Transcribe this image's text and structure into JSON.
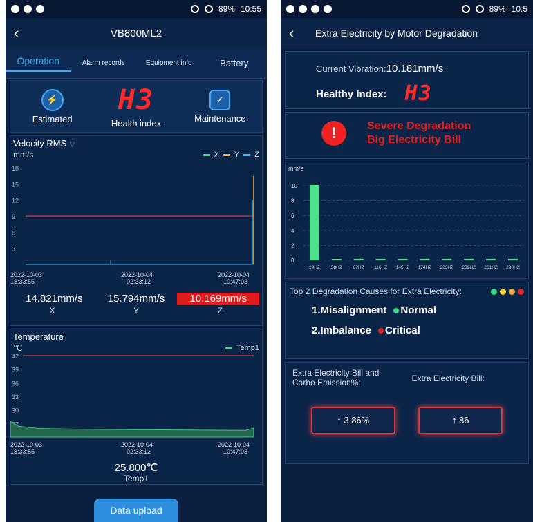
{
  "left": {
    "status": {
      "battery": "89%",
      "time": "10:55"
    },
    "appbar": {
      "title": "VB800ML2"
    },
    "tabs": [
      "Operation",
      "Alarm records",
      "Equipment info",
      "Battery"
    ],
    "cards": {
      "estimated": "Estimated",
      "health_value": "H3",
      "health_label": "Health index",
      "maintenance": "Maintenance"
    },
    "velocity": {
      "title": "Velocity RMS",
      "unit": "mm/s",
      "legend": [
        "X",
        "Y",
        "Z"
      ],
      "x_ticks": [
        [
          "2022-10-03",
          "18:33:55"
        ],
        [
          "2022-10-04",
          "02:33:12"
        ],
        [
          "2022-10-04",
          "10:47:03"
        ]
      ],
      "values": [
        "14.821mm/s",
        "15.794mm/s",
        "10.169mm/s"
      ],
      "axis_labels": [
        "X",
        "Y",
        "Z"
      ]
    },
    "temperature": {
      "title": "Temperature",
      "unit": "℃",
      "legend": "Temp1",
      "x_ticks": [
        [
          "2022-10-03",
          "18:33:55"
        ],
        [
          "2022-10-04",
          "02:33:12"
        ],
        [
          "2022-10-04",
          "10:47:03"
        ]
      ],
      "value": "25.800℃",
      "footer": "Temp1"
    },
    "upload_button": "Data upload"
  },
  "right": {
    "status": {
      "battery": "89%",
      "time": "10:5"
    },
    "appbar": {
      "title": "Extra Electricity by Motor Degradation"
    },
    "vibration_label": "Current Vibration:",
    "vibration_value": "10.181mm/s",
    "healthy_label": "Healthy Index:",
    "healthy_value": "H3",
    "alert_line1": "Severe Degradation",
    "alert_line2": "Big Electricity Bill",
    "chart_unit": "mm/s",
    "causes_title": "Top 2 Degradation Causes for Extra Electricity:",
    "cause1": "1.Misalignment",
    "cause1_status": "Normal",
    "cause2": "2.Imbalance",
    "cause2_status": "Critical",
    "bill_head1": "Extra Electricity Bill and Carbo Emission%:",
    "bill_head2": "Extra Electricity Bill:",
    "bill_value1": "↑ 3.86%",
    "bill_value2": "↑ 86"
  },
  "chart_data": [
    {
      "type": "line",
      "title": "Velocity RMS",
      "ylabel": "mm/s",
      "ylim": [
        0,
        18
      ],
      "y_ticks": [
        3,
        6,
        9,
        12,
        15,
        18
      ],
      "threshold": 9,
      "x": [
        "2022-10-03 18:33:55",
        "2022-10-04 02:33:12",
        "2022-10-04 10:47:03"
      ],
      "series": [
        {
          "name": "X",
          "color": "#3ddc84"
        },
        {
          "name": "Y",
          "color": "#f2a93b"
        },
        {
          "name": "Z",
          "color": "#3fb6f5"
        }
      ]
    },
    {
      "type": "area",
      "title": "Temperature",
      "ylabel": "℃",
      "ylim": [
        24,
        42
      ],
      "y_ticks": [
        27,
        30,
        33,
        36,
        39,
        42
      ],
      "threshold": 42,
      "x": [
        "2022-10-03 18:33:55",
        "2022-10-04 02:33:12",
        "2022-10-04 10:47:03"
      ],
      "series": [
        {
          "name": "Temp1",
          "color": "#3ddc84"
        }
      ]
    },
    {
      "type": "bar",
      "ylabel": "mm/s",
      "ylim": [
        0,
        10
      ],
      "y_ticks": [
        0,
        2,
        4,
        6,
        8,
        10
      ],
      "categories": [
        "29HZ",
        "58HZ",
        "87HZ",
        "116HZ",
        "145HZ",
        "174HZ",
        "203HZ",
        "232HZ",
        "261HZ",
        "290HZ"
      ],
      "values": [
        10.1,
        0.1,
        0.2,
        0.2,
        0.2,
        0.2,
        0.2,
        0.2,
        0.2,
        0.2
      ]
    }
  ],
  "colors": {
    "accent": "#3fa9f5",
    "danger": "#e01b1b",
    "bg": "#0a1f3f"
  }
}
